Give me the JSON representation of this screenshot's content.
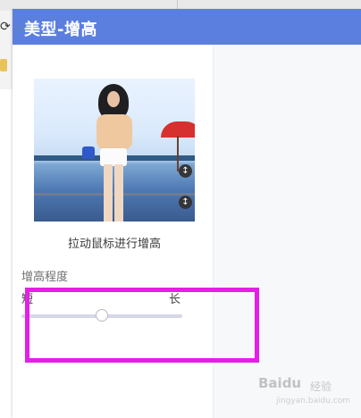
{
  "dialog": {
    "title": "美型-增高",
    "header_color": "#5b7fde"
  },
  "preview": {
    "caption": "拉动鼠标进行增高",
    "handle_icon": "vertical-arrows-icon",
    "handle_glyph": "↕"
  },
  "height_control": {
    "label": "增高程度",
    "min_label": "短",
    "max_label": "长",
    "value_fraction": 0.5
  },
  "watermark": {
    "brand": "Baidu",
    "sub": "经验",
    "url": "jingyan.baidu.com"
  },
  "annotation": {
    "box_color": "#e51ee8"
  }
}
